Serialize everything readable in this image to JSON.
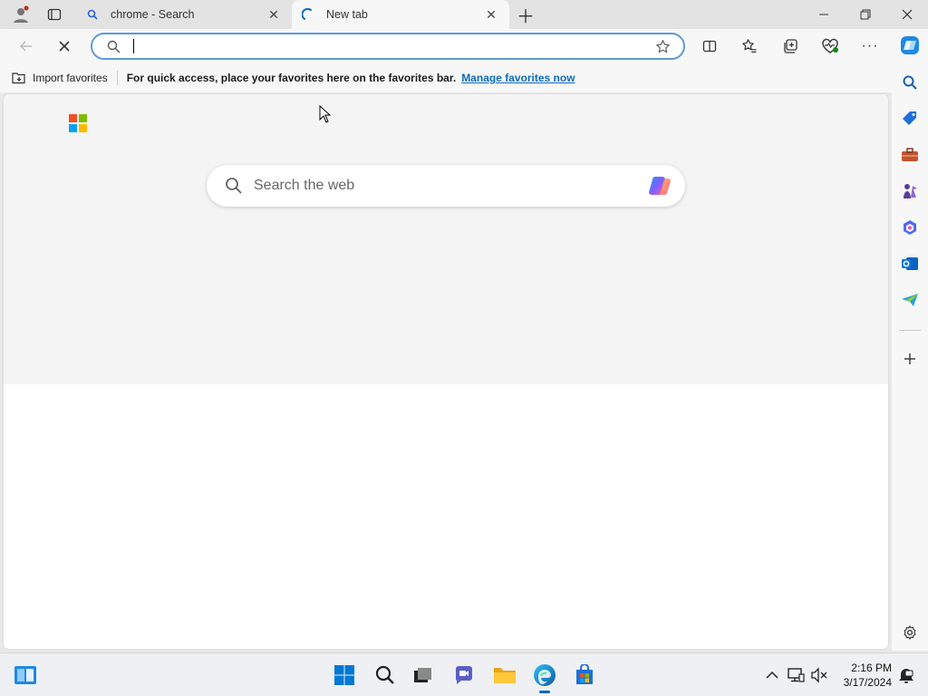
{
  "browser": {
    "tabs": [
      {
        "title": "chrome - Search",
        "icon": "search-icon",
        "active": false
      },
      {
        "title": "New tab",
        "icon": "loading-icon",
        "active": true
      }
    ],
    "address_bar": {
      "value": "",
      "placeholder": ""
    }
  },
  "favorites_bar": {
    "import_label": "Import favorites",
    "hint": "For quick access, place your favorites here on the favorites bar.",
    "manage_link": "Manage favorites now"
  },
  "new_tab_page": {
    "search_placeholder": "Search the web"
  },
  "taskbar": {
    "time": "2:16 PM",
    "date": "3/17/2024"
  },
  "colors": {
    "accent": "#0f6cbd",
    "focus_border": "#5b9bd5",
    "taskbar_bg": "#eef0f3"
  }
}
